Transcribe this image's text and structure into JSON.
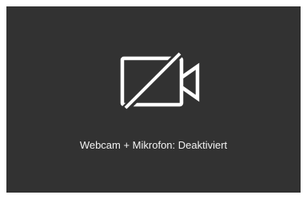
{
  "panel": {
    "background": "#323232",
    "icon": "video-camera-off-icon",
    "status_text": "Webcam + Mikrofon: Deaktiviert",
    "text_color": "#f2f2f2",
    "icon_color": "#ffffff"
  }
}
